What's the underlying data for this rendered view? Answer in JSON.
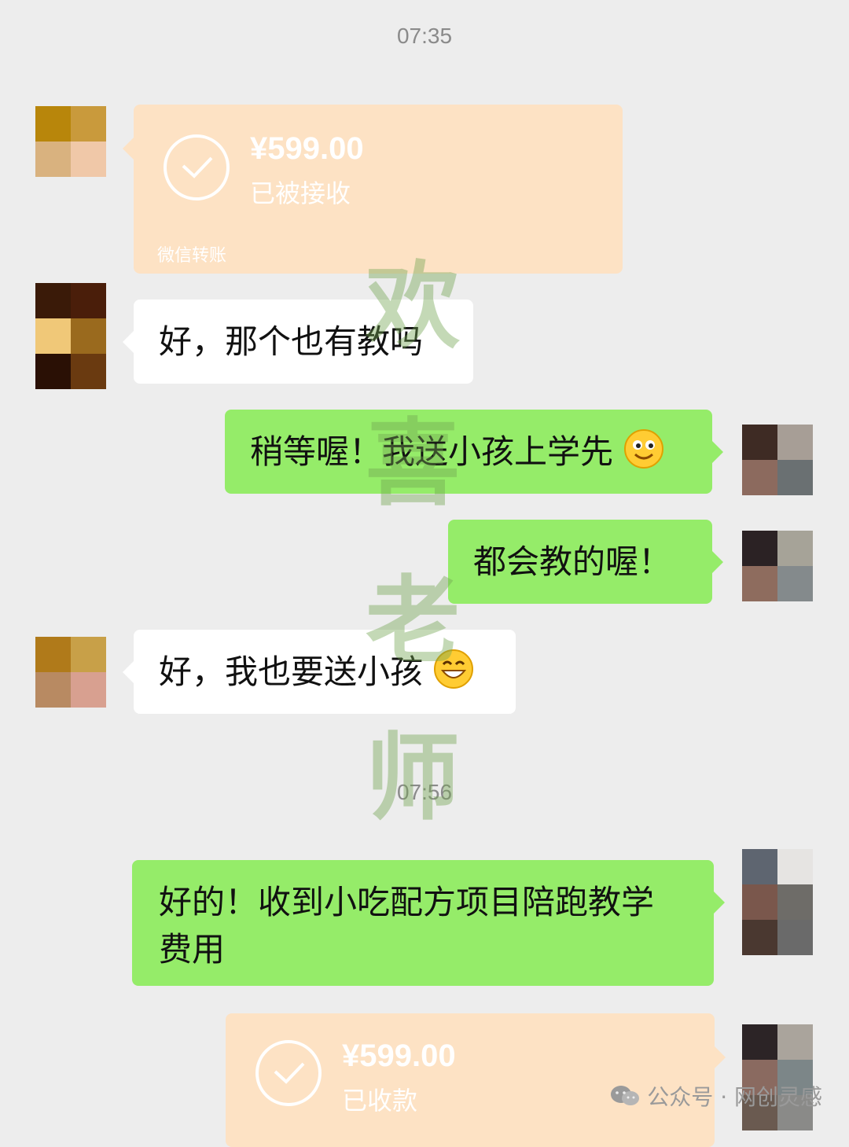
{
  "timestamps": [
    "07:35",
    "07:56"
  ],
  "messages": [
    {
      "type": "transfer",
      "side": "left",
      "amount": "¥599.00",
      "status": "已被接收",
      "footer": "微信转账"
    },
    {
      "type": "text",
      "side": "left",
      "text": "好，那个也有教吗"
    },
    {
      "type": "text",
      "side": "right",
      "text": "稍等喔！我送小孩上学先"
    },
    {
      "type": "text",
      "side": "right",
      "text": "都会教的喔！"
    },
    {
      "type": "text",
      "side": "left",
      "text": "好，我也要送小孩"
    },
    {
      "type": "text",
      "side": "right",
      "line1": "好的！收到小吃配方项目陪跑教学",
      "line2": "费用"
    },
    {
      "type": "transfer",
      "side": "right",
      "amount": "¥599.00",
      "status": "已收款"
    }
  ],
  "emojis": {
    "smile": "smile-emoji",
    "grin": "grin-emoji"
  },
  "watermark": [
    "欢",
    "喜",
    "老",
    "师"
  ],
  "credit": {
    "text": "公众号 · 网创灵感",
    "icon": "wechat-icon"
  },
  "colors": {
    "background": "#ededed",
    "sent_bubble": "#95ec69",
    "received_bubble": "#ffffff",
    "transfer_card": "#fde2c4"
  }
}
